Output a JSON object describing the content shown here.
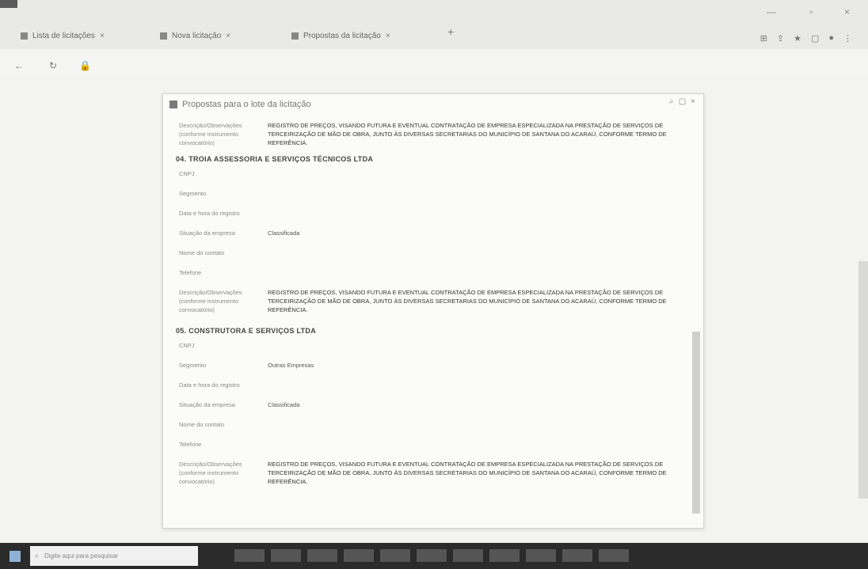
{
  "browser": {
    "tabs": [
      {
        "label": "Lista de licitações"
      },
      {
        "label": "Nova licitação"
      },
      {
        "label": "Propostas da licitação"
      }
    ],
    "url": "",
    "bookmarks": []
  },
  "modal": {
    "title": "Propostas para o lote da licitação",
    "first_item": {
      "label": "Descrição/Observações (conforme instrumento convocatório)",
      "text": "REGISTRO DE PREÇOS, VISANDO FUTURA E EVENTUAL CONTRATAÇÃO DE EMPRESA ESPECIALIZADA NA PRESTAÇÃO DE SERVIÇOS DE TERCEIRIZAÇÃO DE MÃO DE OBRA, JUNTO ÀS DIVERSAS SECRETARIAS DO MUNICÍPIO DE SANTANA DO ACARAÚ, CONFORME TERMO DE REFERÊNCIA."
    },
    "companies": [
      {
        "title": "04. TROIA ASSESSORIA E SERVIÇOS TÉCNICOS LTDA",
        "fields": [
          {
            "k": "CNPJ",
            "v": ""
          },
          {
            "k": "Segmento",
            "v": ""
          },
          {
            "k": "Data e hora do registro",
            "v": ""
          },
          {
            "k": "Situação da empresa",
            "v": "Classificada"
          },
          {
            "k": "Nome do contato",
            "v": ""
          },
          {
            "k": "Telefone",
            "v": ""
          },
          {
            "k": "Descrição/Observações (conforme instrumento convocatório)",
            "v": "REGISTRO DE PREÇOS, VISANDO FUTURA E EVENTUAL CONTRATAÇÃO DE EMPRESA ESPECIALIZADA NA PRESTAÇÃO DE SERVIÇOS DE TERCEIRIZAÇÃO DE MÃO DE OBRA, JUNTO ÀS DIVERSAS SECRETARIAS DO MUNICÍPIO DE SANTANA DO ACARAÚ, CONFORME TERMO DE REFERÊNCIA."
          }
        ]
      },
      {
        "title": "05. CONSTRUTORA E SERVIÇOS LTDA",
        "fields": [
          {
            "k": "CNPJ",
            "v": ""
          },
          {
            "k": "Segmento",
            "v": "Outras Empresas"
          },
          {
            "k": "Data e hora do registro",
            "v": ""
          },
          {
            "k": "Situação da empresa",
            "v": "Classificada"
          },
          {
            "k": "Nome do contato",
            "v": ""
          },
          {
            "k": "Telefone",
            "v": ""
          },
          {
            "k": "Descrição/Observações (conforme instrumento convocatório)",
            "v": "REGISTRO DE PREÇOS, VISANDO FUTURA E EVENTUAL CONTRATAÇÃO DE EMPRESA ESPECIALIZADA NA PRESTAÇÃO DE SERVIÇOS DE TERCEIRIZAÇÃO DE MÃO DE OBRA, JUNTO ÀS DIVERSAS SECRETARIAS DO MUNICÍPIO DE SANTANA DO ACARAÚ, CONFORME TERMO DE REFERÊNCIA."
          }
        ]
      }
    ]
  },
  "taskbar": {
    "search_placeholder": "Digite aqui para pesquisar",
    "items": [
      "",
      "",
      "",
      "",
      "",
      "",
      "",
      "",
      "",
      "",
      ""
    ],
    "tray_text": "",
    "colors": {
      "bar": "#2b2b2b",
      "start": "#8fb3d6"
    }
  },
  "icons": {
    "reload": "reload-icon",
    "back": "back-icon",
    "search": "search-icon",
    "close": "close-icon",
    "minimize": "minimize-icon",
    "maximize": "maximize-icon"
  }
}
